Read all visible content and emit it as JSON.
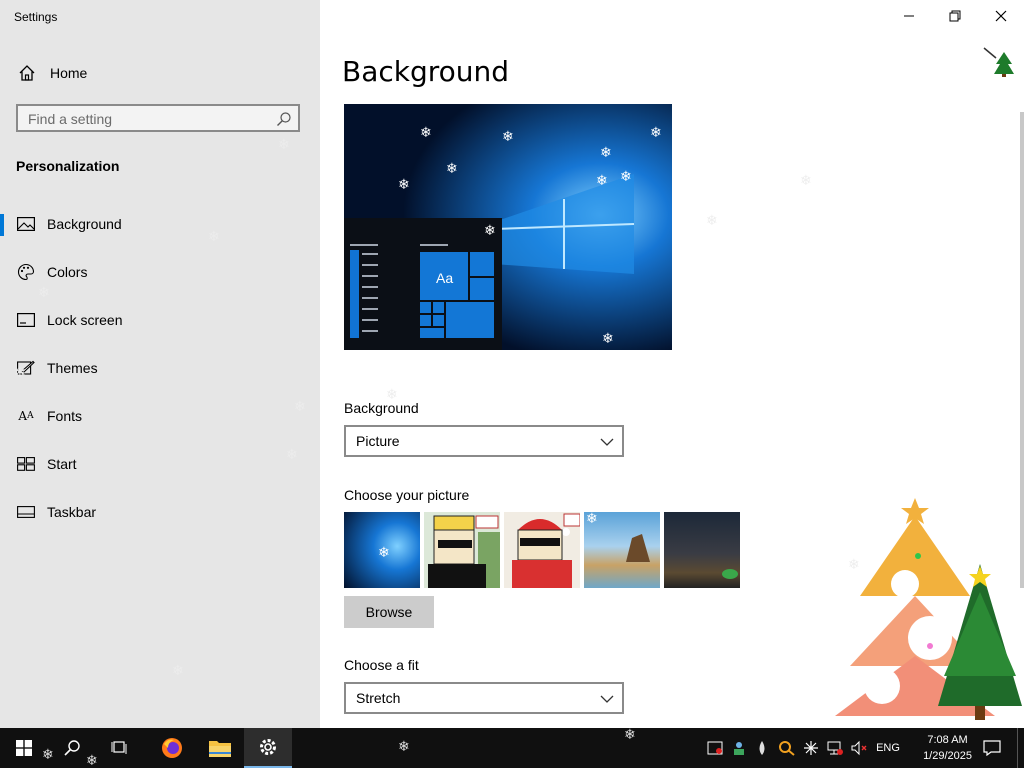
{
  "window": {
    "title": "Settings"
  },
  "sidebar": {
    "home_label": "Home",
    "search_placeholder": "Find a setting",
    "section_title": "Personalization",
    "items": [
      {
        "label": "Background",
        "icon": "picture-icon"
      },
      {
        "label": "Colors",
        "icon": "palette-icon"
      },
      {
        "label": "Lock screen",
        "icon": "lock-screen-icon"
      },
      {
        "label": "Themes",
        "icon": "brush-icon"
      },
      {
        "label": "Fonts",
        "icon": "fonts-icon"
      },
      {
        "label": "Start",
        "icon": "start-icon"
      },
      {
        "label": "Taskbar",
        "icon": "taskbar-icon"
      }
    ],
    "active_index": 0
  },
  "main": {
    "title": "Background",
    "preview": {
      "tile_text": "Aa"
    },
    "background_label": "Background",
    "background_value": "Picture",
    "choose_picture_label": "Choose your picture",
    "browse_label": "Browse",
    "fit_label": "Choose a fit",
    "fit_value": "Stretch"
  },
  "taskbar": {
    "language": "ENG",
    "time": "7:08 AM",
    "date": "1/29/2025"
  },
  "colors": {
    "accent": "#0078d7",
    "sidebar_bg": "#e6e6e6",
    "taskbar_bg": "#101010"
  }
}
